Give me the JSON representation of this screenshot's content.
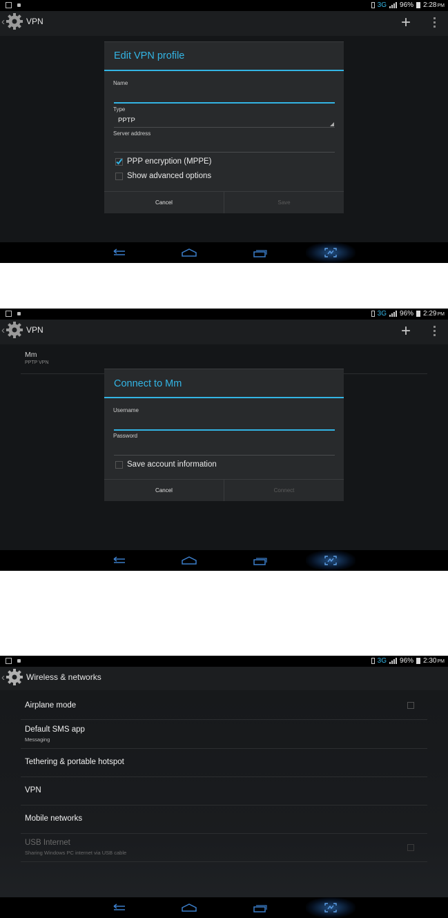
{
  "screen1": {
    "status": {
      "network": "3G",
      "battery": "96%",
      "time": "2:28",
      "ampm": "PM"
    },
    "action_bar": {
      "title": "VPN"
    },
    "dialog": {
      "title": "Edit VPN profile",
      "name_label": "Name",
      "type_label": "Type",
      "type_value": "PPTP",
      "server_label": "Server address",
      "ppp_encryption": {
        "label": "PPP encryption (MPPE)",
        "checked": true
      },
      "advanced": {
        "label": "Show advanced options",
        "checked": false
      },
      "cancel_label": "Cancel",
      "save_label": "Save"
    }
  },
  "screen2": {
    "status": {
      "network": "3G",
      "battery": "96%",
      "time": "2:29",
      "ampm": "PM"
    },
    "action_bar": {
      "title": "VPN"
    },
    "vpn_item": {
      "name": "Mm",
      "type": "PPTP VPN"
    },
    "dialog": {
      "title": "Connect to Mm",
      "username_label": "Username",
      "password_label": "Password",
      "save_account": {
        "label": "Save account information",
        "checked": false
      },
      "cancel_label": "Cancel",
      "connect_label": "Connect"
    }
  },
  "screen3": {
    "status": {
      "network": "3G",
      "battery": "96%",
      "time": "2:30",
      "ampm": "PM"
    },
    "action_bar": {
      "title": "Wireless & networks"
    },
    "items": [
      {
        "title": "Airplane mode",
        "checkbox": true,
        "checked": false,
        "enabled": true
      },
      {
        "title": "Default SMS app",
        "subtitle": "Messaging",
        "enabled": true
      },
      {
        "title": "Tethering & portable hotspot",
        "enabled": true
      },
      {
        "title": "VPN",
        "enabled": true
      },
      {
        "title": "Mobile networks",
        "enabled": true
      },
      {
        "title": "USB Internet",
        "subtitle": "Sharing Windows PC internet via USB cable",
        "checkbox": true,
        "checked": false,
        "enabled": false
      }
    ]
  },
  "nav": {
    "icons": [
      "back-icon",
      "home-icon",
      "recent-apps-icon",
      "screenshot-icon"
    ]
  },
  "colors": {
    "accent": "#33b5e5",
    "background": "#141618",
    "dialog": "#282a2c"
  }
}
